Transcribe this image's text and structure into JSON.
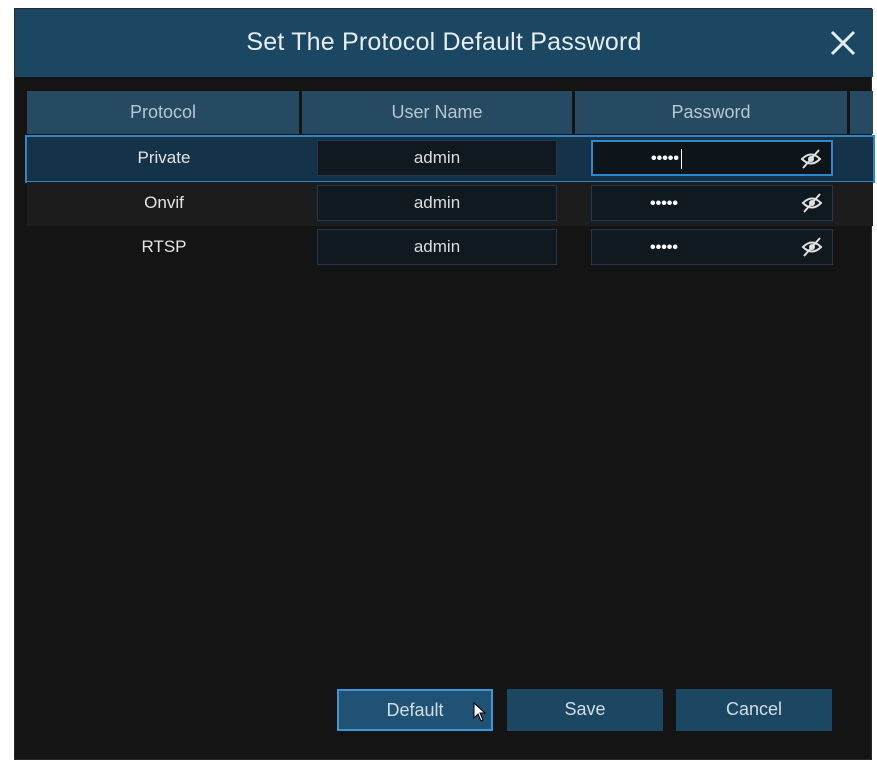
{
  "dialog": {
    "title": "Set The Protocol Default Password"
  },
  "table": {
    "headers": [
      "Protocol",
      "User Name",
      "Password"
    ],
    "rows": [
      {
        "protocol": "Private",
        "user_name": "admin",
        "password_mask": "•••••"
      },
      {
        "protocol": "Onvif",
        "user_name": "admin",
        "password_mask": "•••••"
      },
      {
        "protocol": "RTSP",
        "user_name": "admin",
        "password_mask": "•••••"
      }
    ]
  },
  "buttons": {
    "default_label": "Default",
    "save_label": "Save",
    "cancel_label": "Cancel"
  },
  "icons": {
    "close": "close-icon",
    "toggle_password": "eye-slash-icon",
    "pointer": "mouse-pointer-icon"
  },
  "colors": {
    "titlebar": "#1b4763",
    "background": "#141414",
    "accent": "#2e86c5"
  }
}
